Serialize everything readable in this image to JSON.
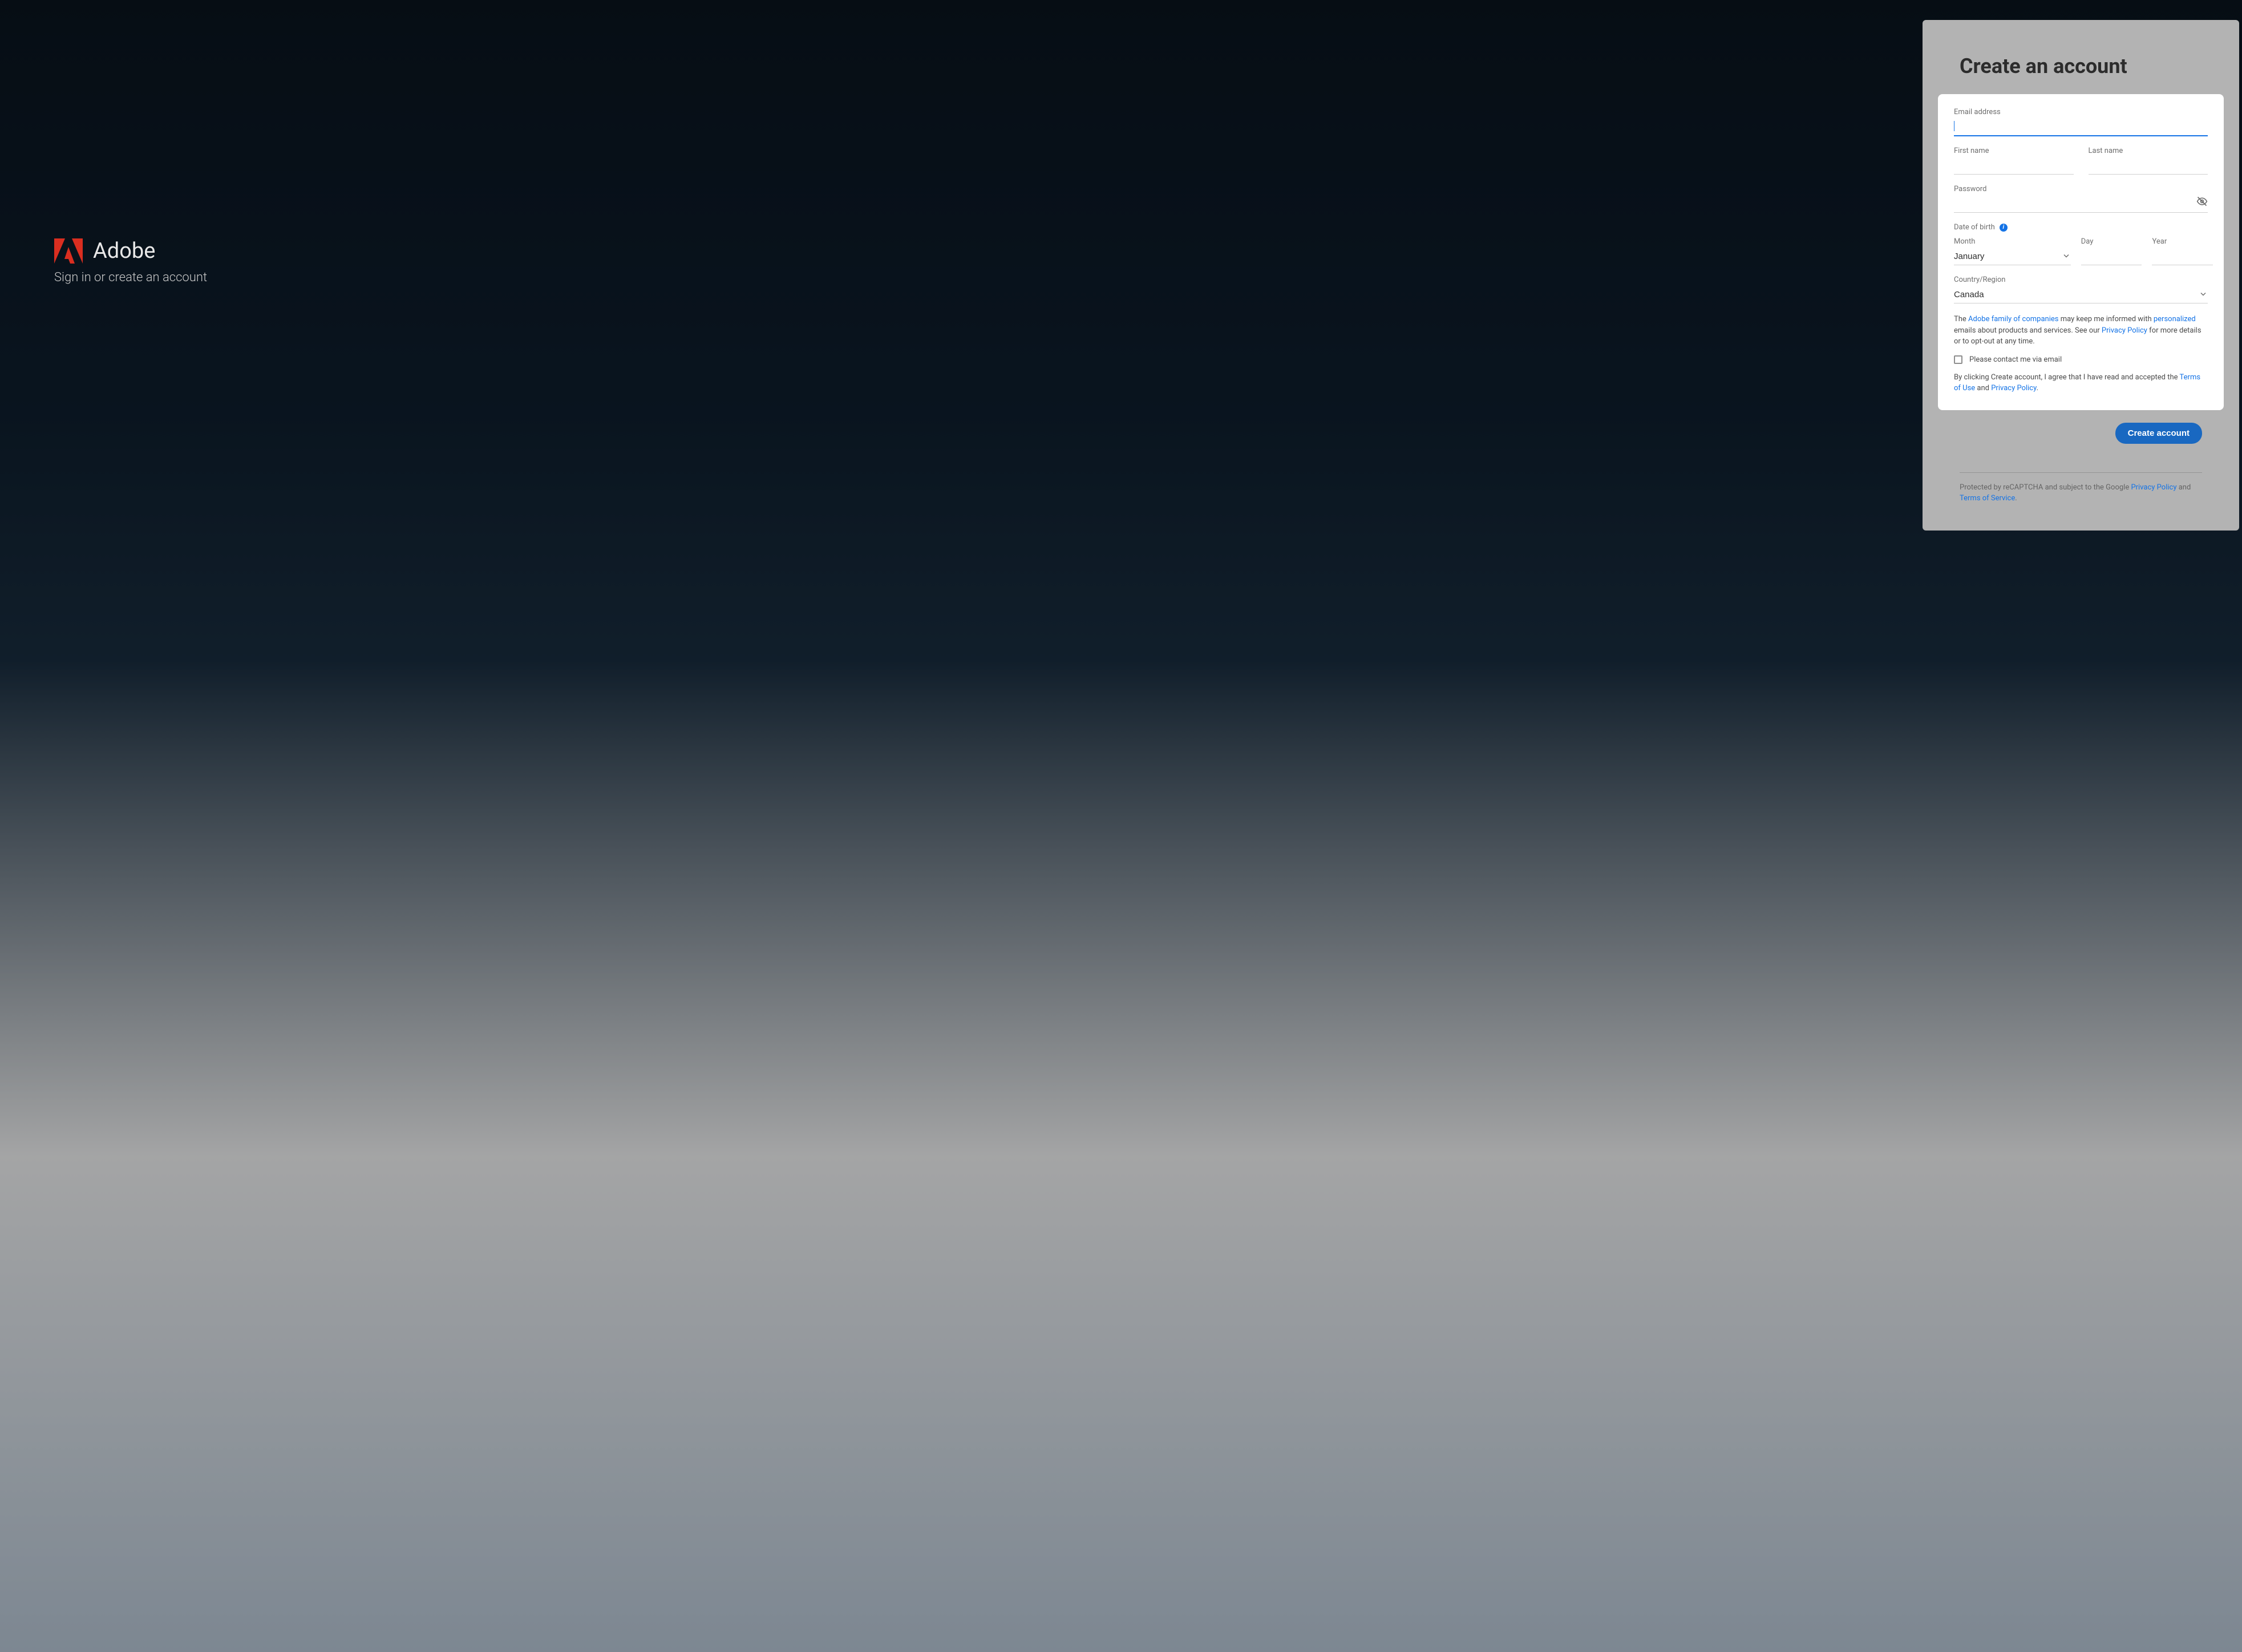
{
  "brand": {
    "name": "Adobe",
    "tagline": "Sign in or create an account"
  },
  "form": {
    "title": "Create an account",
    "email_label": "Email address",
    "first_name_label": "First name",
    "last_name_label": "Last name",
    "password_label": "Password",
    "dob_label": "Date of birth",
    "month_label": "Month",
    "month_value": "January",
    "day_label": "Day",
    "year_label": "Year",
    "country_label": "Country/Region",
    "country_value": "Canada",
    "consent_pre": "The ",
    "consent_link1": "Adobe family of companies",
    "consent_mid1": " may keep me informed with ",
    "consent_link2": "personalized",
    "consent_mid2": " emails about products and services. See our ",
    "consent_link3": "Privacy Policy",
    "consent_post": " for more details or to opt-out at any time.",
    "contact_label": "Please contact me via email",
    "agree_pre": "By clicking Create account, I agree that I have read and accepted the ",
    "agree_link1": "Terms of Use",
    "agree_mid": " and ",
    "agree_link2": "Privacy Policy",
    "agree_post": ".",
    "submit": "Create account",
    "recaptcha_pre": "Protected by reCAPTCHA and subject to the Google ",
    "recaptcha_link1": "Privacy Policy",
    "recaptcha_mid": " and ",
    "recaptcha_link2": "Terms of Service",
    "recaptcha_post": "."
  }
}
